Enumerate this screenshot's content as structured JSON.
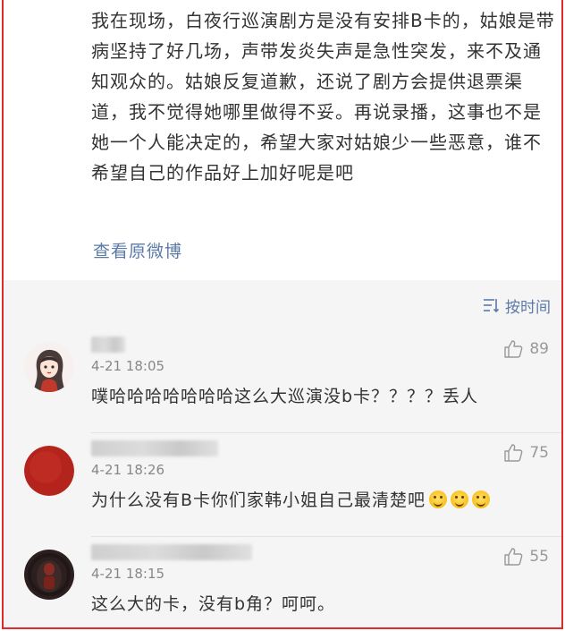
{
  "post": {
    "text": "我在现场，白夜行巡演剧方是没有安排B卡的，姑娘是带病坚持了好几场，声带发炎失声是急性突发，来不及通知观众的。姑娘反复道歉，还说了剧方会提供退票渠道，我不觉得她哪里做得不妥。再说录播，这事也不是她一个人能决定的，希望大家对姑娘少一些恶意，谁不希望自己的作品好上加好呢是吧",
    "view_original_label": "查看原微博"
  },
  "comments_section": {
    "sort_label": "按时间",
    "sort_icon": "sort-by-time-icon",
    "comments": [
      {
        "time": "4-21 18:05",
        "likes": "89",
        "text": "噗哈哈哈哈哈哈哈这么大巡演没b卡？？？？丢人",
        "avatar_style": "anime-girl"
      },
      {
        "time": "4-21 18:26",
        "likes": "75",
        "text": "为什么没有B卡你们家韩小姐自己最清楚吧",
        "emoji_count": 3,
        "avatar_style": "red-circle"
      },
      {
        "time": "4-21 18:15",
        "likes": "55",
        "text": "这么大的卡，没有b角？呵呵。",
        "avatar_style": "dark-photo"
      }
    ]
  },
  "colors": {
    "frame_border": "#e02b2b",
    "link": "#5b7aa8",
    "comments_bg": "#f5f5f5"
  }
}
